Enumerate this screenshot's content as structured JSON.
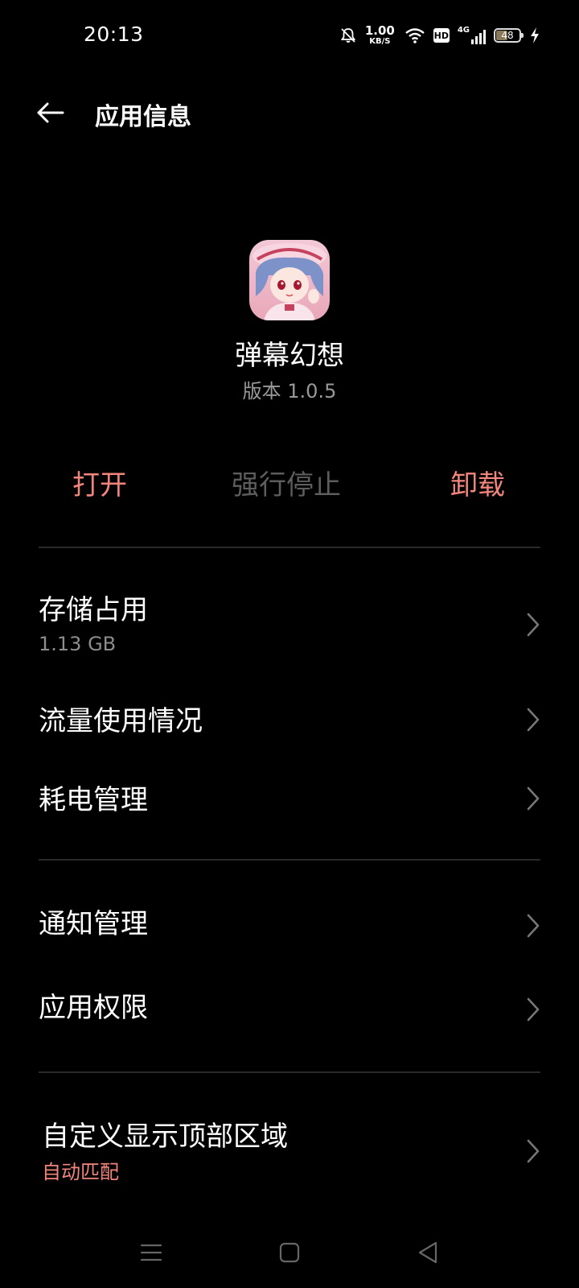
{
  "status_bar": {
    "time": "20:13",
    "net_speed_value": "1.00",
    "net_speed_unit": "KB/S",
    "hd_label": "HD",
    "network_type": "4G",
    "battery_level": "48",
    "icons": [
      "mute-bell-icon",
      "wifi-icon",
      "hd-icon",
      "signal-4g-icon",
      "battery-icon",
      "charging-icon"
    ]
  },
  "header": {
    "title": "应用信息",
    "back_icon": "back-arrow-icon"
  },
  "app": {
    "name": "弹幕幻想",
    "version": "版本 1.0.5"
  },
  "actions": {
    "open": "打开",
    "force_stop": "强行停止",
    "uninstall": "卸载"
  },
  "list": {
    "storage": {
      "label": "存储占用",
      "value": "1.13 GB"
    },
    "data_usage": {
      "label": "流量使用情况"
    },
    "battery_management": {
      "label": "耗电管理"
    },
    "notification_management": {
      "label": "通知管理"
    },
    "app_permissions": {
      "label": "应用权限"
    },
    "custom_top_area": {
      "label": "自定义显示顶部区域",
      "value": "自动匹配"
    }
  },
  "colors": {
    "accent": "#f2857c",
    "disabled": "#5d5d5d",
    "secondary_text": "#8c8c8c",
    "background": "#000000"
  },
  "nav_bar": {
    "icons": [
      "menu-icon",
      "home-icon",
      "back-triangle-icon"
    ]
  }
}
